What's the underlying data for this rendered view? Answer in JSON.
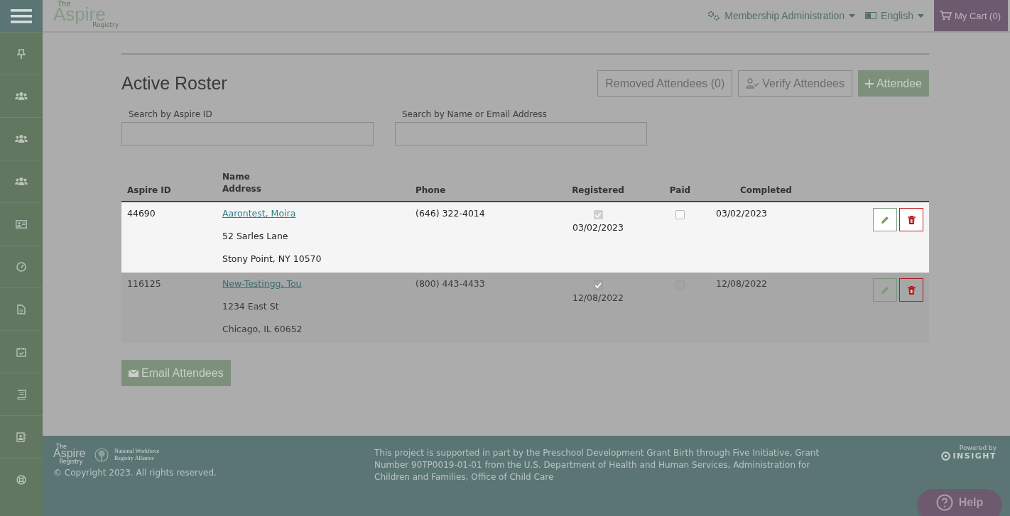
{
  "header": {
    "logo": {
      "small": "The",
      "main": "Aspire",
      "sub": "Registry"
    },
    "admin_menu": "Membership Administration",
    "language": "English",
    "cart": "My Cart (0)"
  },
  "sidebar": {
    "items": [
      {
        "kind": "pin"
      },
      {
        "kind": "group"
      },
      {
        "kind": "group"
      },
      {
        "kind": "group"
      },
      {
        "kind": "idcard"
      },
      {
        "kind": "gauge"
      },
      {
        "kind": "file"
      },
      {
        "kind": "calendar"
      },
      {
        "kind": "book"
      },
      {
        "kind": "contact"
      },
      {
        "kind": "lifebuoy"
      }
    ]
  },
  "roster": {
    "title": "Active Roster",
    "buttons": [
      {
        "label": "Removed Attendees (0)",
        "kind": "outline"
      },
      {
        "label": "Verify Attendees",
        "kind": "verify"
      },
      {
        "label": "Attendee",
        "kind": "add"
      }
    ],
    "search": [
      {
        "label": "Search by Aspire ID"
      },
      {
        "label": "Search by Name or Email Address"
      }
    ],
    "table": {
      "columns": [
        "Aspire ID",
        "Name",
        "Address",
        "Phone",
        "Registered",
        "Paid",
        "Completed"
      ],
      "rows": [
        {
          "highlighted": true,
          "aspire_id": "44690",
          "name": "Aarontest, Moira",
          "address": [
            "52 Sarles Lane",
            "Stony Point, NY  10570"
          ],
          "phone": "(646) 322-4014",
          "registered": true,
          "registered_date": "03/02/2023",
          "paid": false,
          "completed": "03/02/2023"
        },
        {
          "highlighted": false,
          "aspire_id": "116125",
          "name": "New-Testingg, Tou",
          "address": [
            "1234 East St",
            "Chicago, IL  60652"
          ],
          "phone": "(800) 443-4433",
          "registered": true,
          "registered_date": "12/08/2022",
          "paid": false,
          "completed": "12/08/2022"
        }
      ]
    },
    "email_button": "Email Attendees"
  },
  "footer": {
    "logo": {
      "small": "The",
      "main": "Aspire",
      "sub": "Registry"
    },
    "partner": [
      "National Workforce",
      "Registry Alliance"
    ],
    "copyright": "© Copyright 2023. All rights reserved.",
    "notice": "This project is supported in part by the Preschool Development Grant Birth through Five Initiative, Grant Number 90TP0019-01-01 from the U.S. Department of Health and Human Services, Administration for Children and Families, Office of Child Care",
    "powered_by": "Powered by",
    "insight": "INSIGHT",
    "help": "Help"
  }
}
